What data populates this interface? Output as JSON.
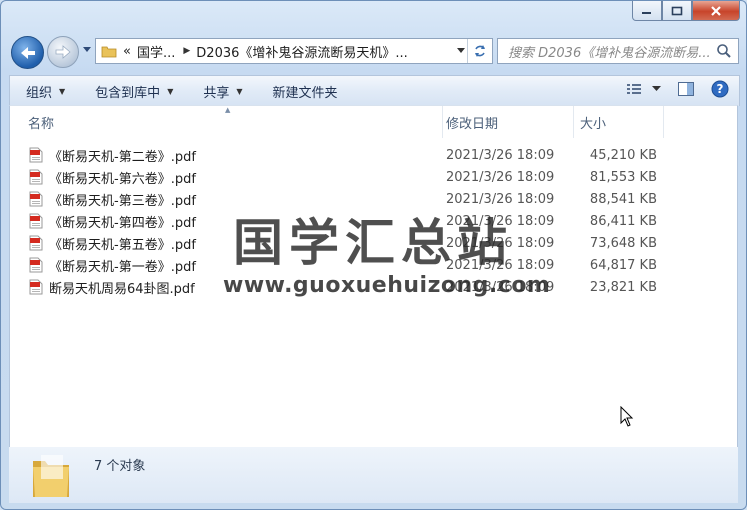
{
  "window": {
    "caption_buttons": [
      "minimize",
      "maximize",
      "close"
    ]
  },
  "navigation": {
    "breadcrumb": [
      {
        "label": "«"
      },
      {
        "label": "国学..."
      },
      {
        "label": "D2036《增补鬼谷源流断易天机》..."
      }
    ],
    "search_placeholder": "搜索 D2036《增补鬼谷源流断易..."
  },
  "toolbar": {
    "items": [
      {
        "label": "组织",
        "has_menu": true
      },
      {
        "label": "包含到库中",
        "has_menu": true
      },
      {
        "label": "共享",
        "has_menu": true
      },
      {
        "label": "新建文件夹",
        "has_menu": false
      }
    ]
  },
  "columns": {
    "name": "名称",
    "date": "修改日期",
    "size": "大小"
  },
  "files": [
    {
      "name": "《断易天机-第二卷》.pdf",
      "date": "2021/3/26 18:09",
      "size": "45,210 KB",
      "type": "pdf"
    },
    {
      "name": "《断易天机-第六卷》.pdf",
      "date": "2021/3/26 18:09",
      "size": "81,553 KB",
      "type": "pdf"
    },
    {
      "name": "《断易天机-第三卷》.pdf",
      "date": "2021/3/26 18:09",
      "size": "88,541 KB",
      "type": "pdf"
    },
    {
      "name": "《断易天机-第四卷》.pdf",
      "date": "2021/3/26 18:09",
      "size": "86,411 KB",
      "type": "pdf"
    },
    {
      "name": "《断易天机-第五卷》.pdf",
      "date": "2021/3/26 18:09",
      "size": "73,648 KB",
      "type": "pdf"
    },
    {
      "name": "《断易天机-第一卷》.pdf",
      "date": "2021/3/26 18:09",
      "size": "64,817 KB",
      "type": "pdf"
    },
    {
      "name": "断易天机周易64卦图.pdf",
      "date": "2021/3/26 18:09",
      "size": "23,821 KB",
      "type": "pdf"
    }
  ],
  "watermark": {
    "title": "国学汇总站",
    "url": "www.guoxuehuizong.com"
  },
  "status": {
    "item_count": "7 个对象"
  },
  "colors": {
    "frame": "#c6daf1",
    "pdf_icon": "#d42a1f",
    "folder": "#e9c25a"
  }
}
